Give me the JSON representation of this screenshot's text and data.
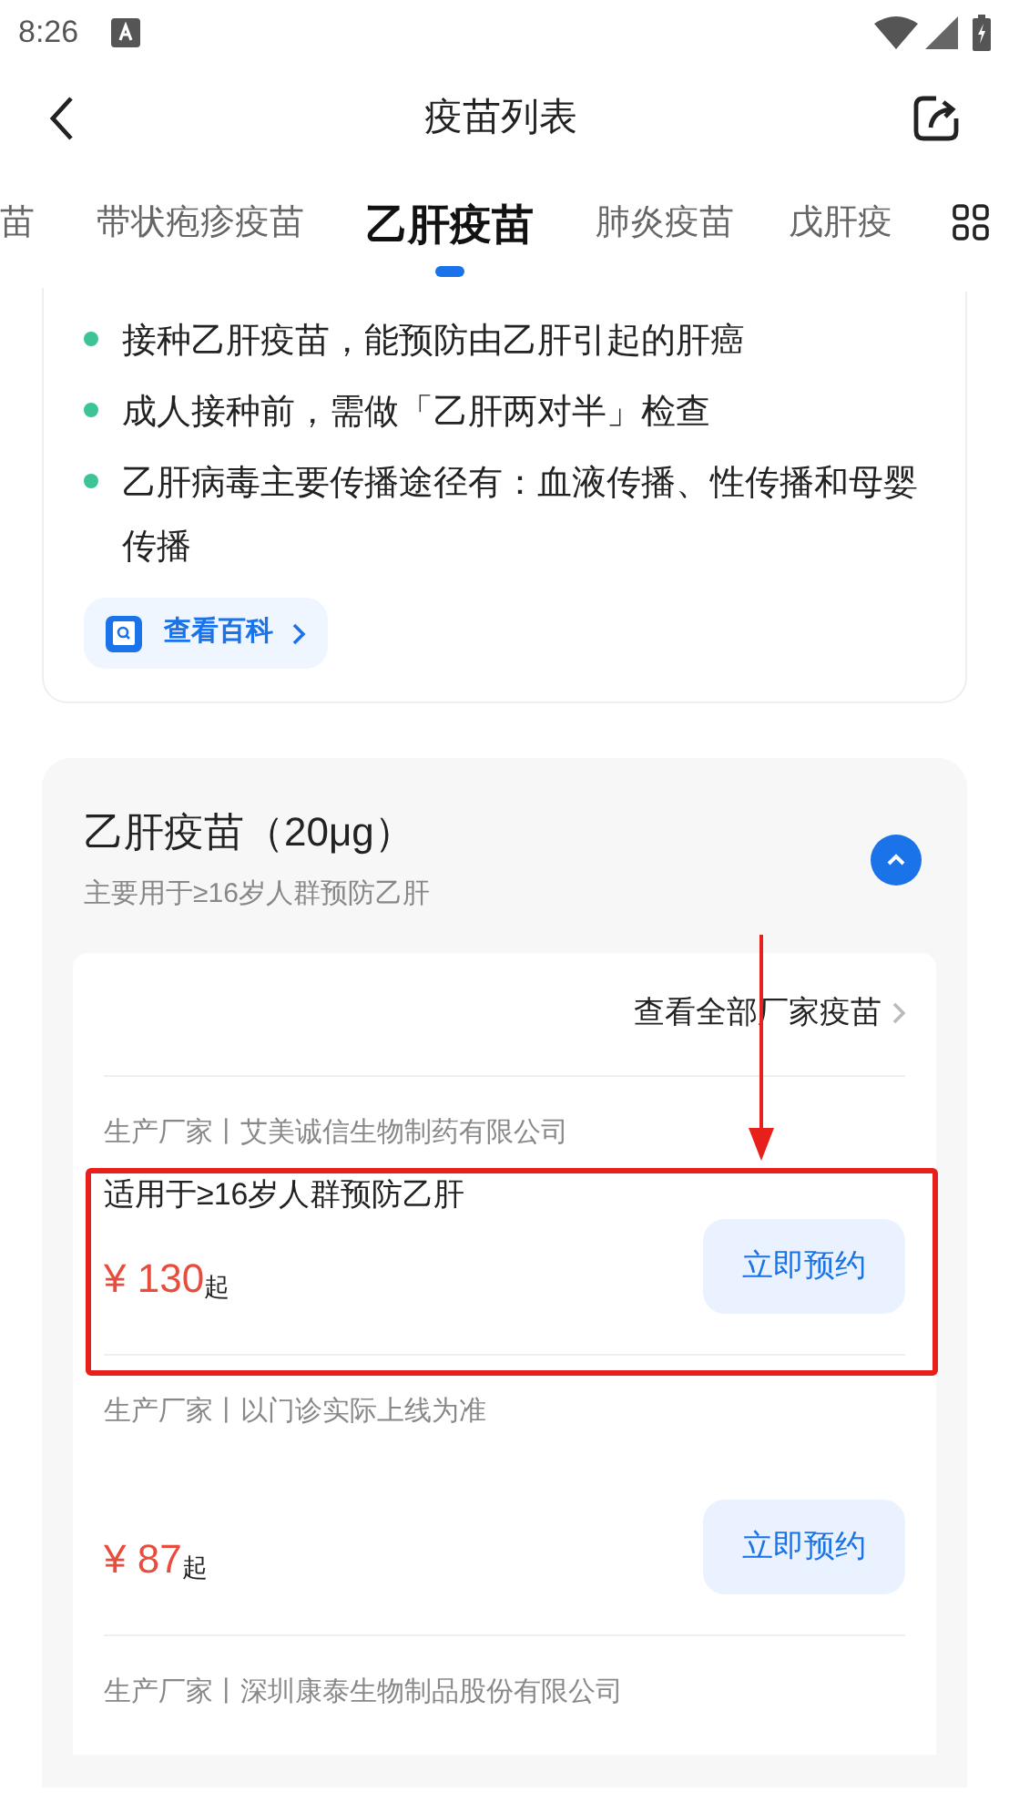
{
  "status_bar": {
    "time": "8:26"
  },
  "nav": {
    "title": "疫苗列表"
  },
  "tabs": [
    {
      "label": "苗",
      "selected": false
    },
    {
      "label": "带状疱疹疫苗",
      "selected": false
    },
    {
      "label": "乙肝疫苗",
      "selected": true
    },
    {
      "label": "肺炎疫苗",
      "selected": false
    },
    {
      "label": "戊肝疫",
      "selected": false
    }
  ],
  "info": {
    "bullets": [
      "接种乙肝疫苗，能预防由乙肝引起的肝癌",
      "成人接种前，需做「乙肝两对半」检查",
      "乙肝病毒主要传播途径有：血液传播、性传播和母婴传播"
    ],
    "link": "查看百科"
  },
  "vaccine_group": {
    "title": "乙肝疫苗（20μg）",
    "subtitle": "主要用于≥16岁人群预防乙肝",
    "expanded": true,
    "view_all": "查看全部厂家疫苗",
    "products": [
      {
        "manufacturer": "生产厂家丨艾美诚信生物制药有限公司",
        "description": "适用于≥16岁人群预防乙肝",
        "price": "¥ 130",
        "price_suffix": "起",
        "button": "立即预约",
        "highlighted": true
      },
      {
        "manufacturer": "生产厂家丨以门诊实际上线为准",
        "price": "¥ 87",
        "price_suffix": "起",
        "button": "立即预约",
        "highlighted": false
      },
      {
        "manufacturer": "生产厂家丨深圳康泰生物制品股份有限公司",
        "highlighted": false
      }
    ]
  }
}
